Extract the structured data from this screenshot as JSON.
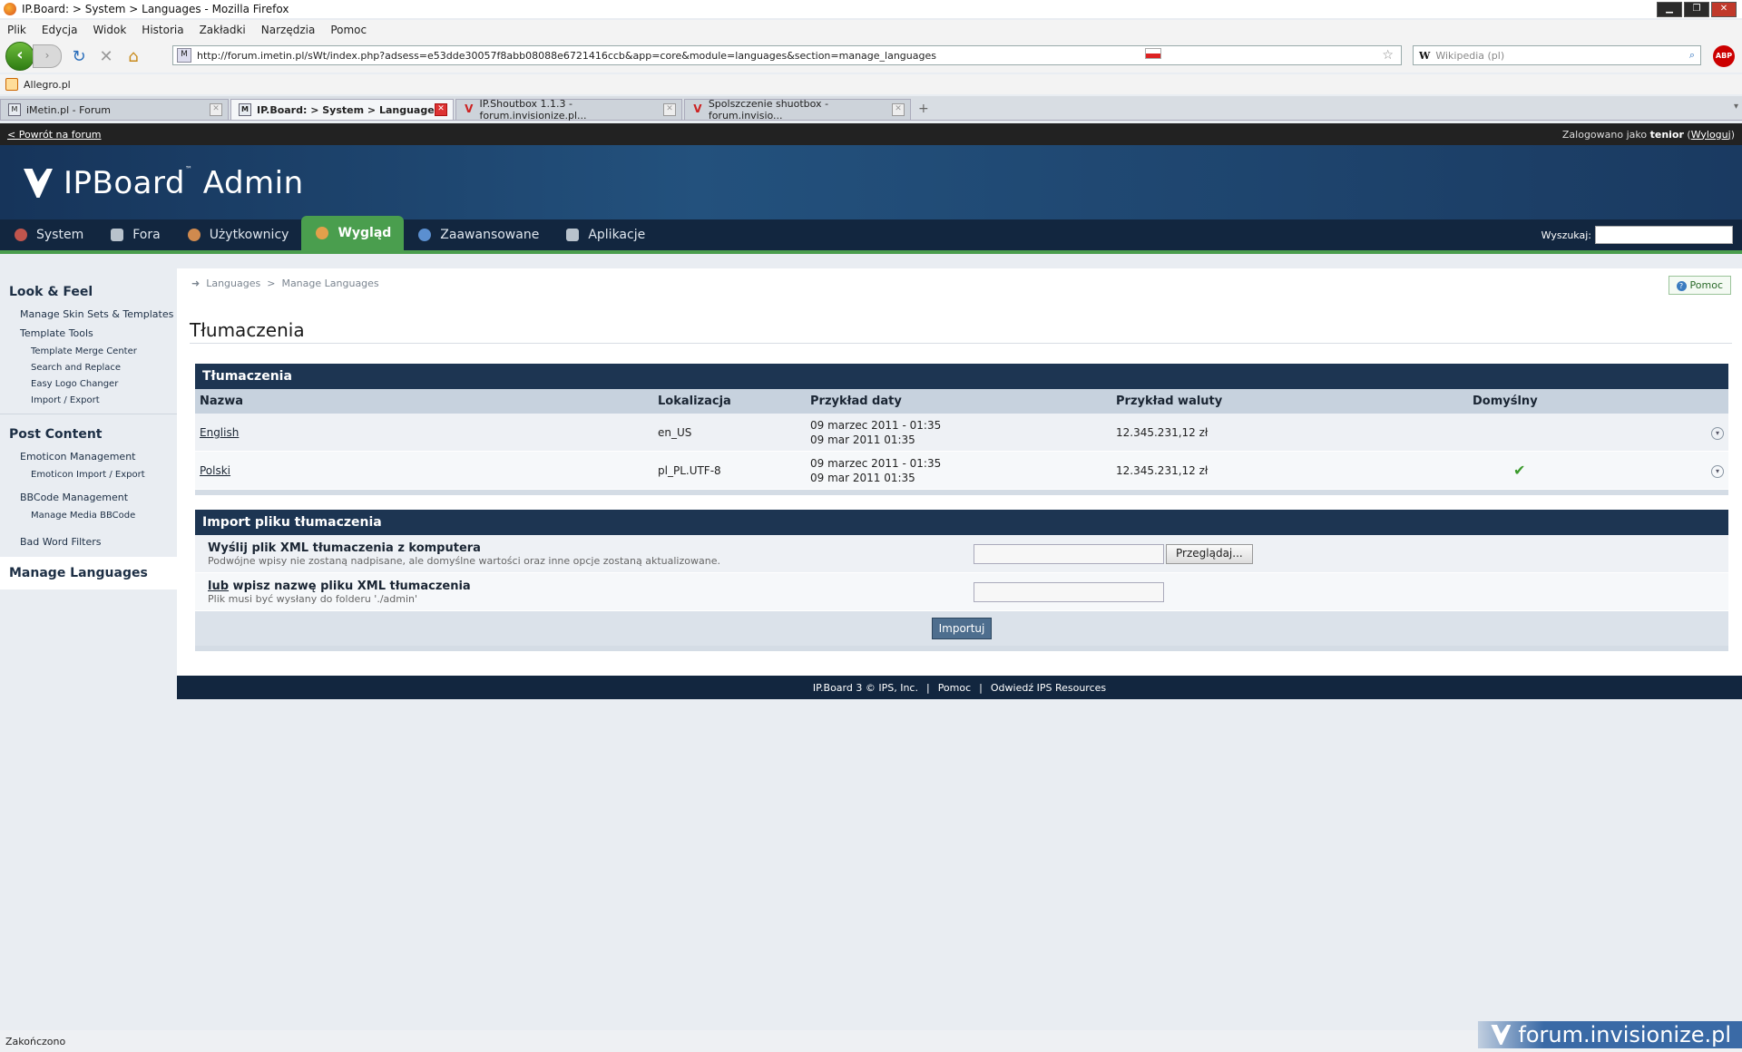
{
  "browser": {
    "window_title": "IP.Board: > System > Languages - Mozilla Firefox",
    "menu": [
      "Plik",
      "Edycja",
      "Widok",
      "Historia",
      "Zakładki",
      "Narzędzia",
      "Pomoc"
    ],
    "url": "http://forum.imetin.pl/sWt/index.php?adsess=e53dde30057f8abb08088e6721416ccb&app=core&module=languages&section=manage_languages",
    "search_placeholder": "Wikipedia (pl)",
    "bookmark": "Allegro.pl",
    "tabs": [
      {
        "label": "iMetin.pl - Forum",
        "active": false
      },
      {
        "label": "IP.Board: > System > Languages",
        "active": true
      },
      {
        "label": "IP.Shoutbox 1.1.3 - forum.invisionize.pl...",
        "active": false
      },
      {
        "label": "Spolszczenie shuotbox - forum.invisio...",
        "active": false
      }
    ],
    "status": "Zakończono"
  },
  "admin": {
    "back_link": "< Powrót na forum",
    "logged_prefix": "Zalogowano jako ",
    "logged_user": "tenior",
    "logout": "Wyloguj",
    "logo_text": "IPBoard",
    "logo_suffix": " Admin",
    "nav": [
      {
        "label": "System",
        "color": "#c0554d"
      },
      {
        "label": "Fora",
        "color": "#b8c2cc"
      },
      {
        "label": "Użytkownicy",
        "color": "#d08a4e"
      },
      {
        "label": "Wygląd",
        "color": "#e2a04b"
      },
      {
        "label": "Zaawansowane",
        "color": "#5b8fd0"
      },
      {
        "label": "Aplikacje",
        "color": "#b8c2cc"
      }
    ],
    "search_label": "Wyszukaj:"
  },
  "sidebar": {
    "sections": [
      {
        "title": "Look & Feel",
        "items": [
          "Manage Skin Sets & Templates",
          "Template Tools"
        ],
        "subitems": [
          "Template Merge Center",
          "Search and Replace",
          "Easy Logo Changer",
          "Import / Export"
        ]
      },
      {
        "title": "Post Content",
        "items": [
          "Emoticon Management",
          "BBCode Management",
          "Bad Word Filters"
        ],
        "subitems": [
          "Emoticon Import / Export",
          "Manage Media BBCode"
        ]
      }
    ],
    "active": "Manage Languages"
  },
  "main": {
    "breadcrumb": [
      "Languages",
      "Manage Languages"
    ],
    "help": "Pomoc",
    "title": "Tłumaczenia",
    "table": {
      "heading": "Tłumaczenia",
      "columns": [
        "Nazwa",
        "Lokalizacja",
        "Przykład daty",
        "Przykład waluty",
        "Domyślny"
      ],
      "rows": [
        {
          "name": "English",
          "locale": "en_US",
          "date1": "09 marzec 2011 - 01:35",
          "date2": "09 mar 2011 01:35",
          "currency": "12.345.231,12 zł",
          "default": false
        },
        {
          "name": "Polski",
          "locale": "pl_PL.UTF-8",
          "date1": "09 marzec 2011 - 01:35",
          "date2": "09 mar 2011 01:35",
          "currency": "12.345.231,12 zł",
          "default": true
        }
      ]
    },
    "import": {
      "heading": "Import pliku tłumaczenia",
      "upload_title": "Wyślij plik XML tłumaczenia z komputera",
      "upload_desc": "Podwójne wpisy nie zostaną nadpisane, ale domyślne wartości oraz inne opcje zostaną aktualizowane.",
      "browse": "Przeglądaj...",
      "or_word": "lub",
      "file_title": " wpisz nazwę pliku XML tłumaczenia",
      "file_desc": "Plik musi być wysłany do folderu './admin'",
      "submit": "Importuj"
    }
  },
  "footer": {
    "copyright": "IP.Board 3 © IPS, Inc.",
    "help": "Pomoc",
    "resources": "Odwiedź IPS Resources"
  },
  "watermark": "forum.invisionize.pl"
}
